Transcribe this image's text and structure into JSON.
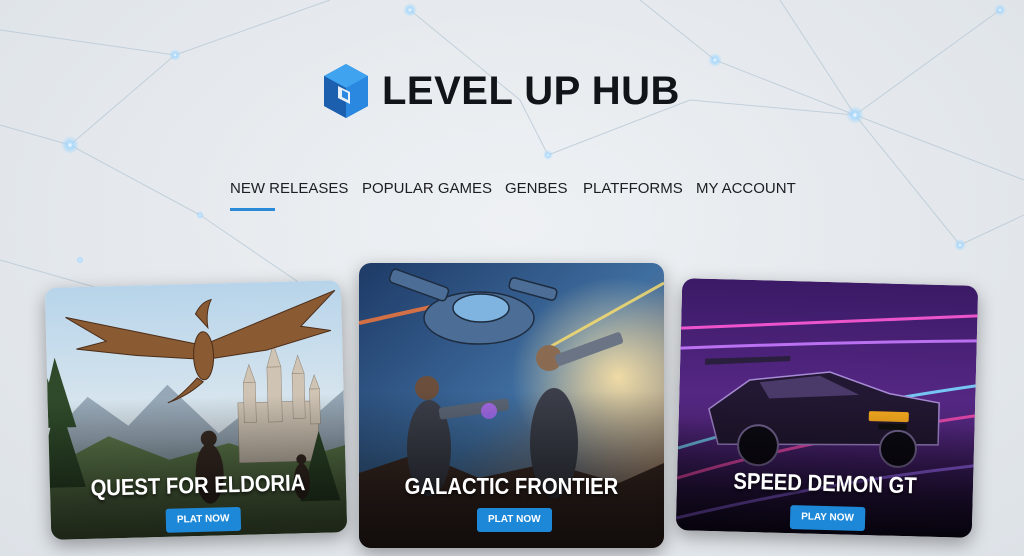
{
  "brand": {
    "name": "LEVEL UP HUB",
    "accent": "#2a8ad8"
  },
  "nav": {
    "active": "NEW RELEASES",
    "items": [
      {
        "label": "NEW RELEASES"
      },
      {
        "label": "POPULAR GAMES"
      },
      {
        "label": "GENBES"
      },
      {
        "label": "PLATFFORMS"
      },
      {
        "label": "MY ACCOUNT"
      }
    ]
  },
  "games": [
    {
      "title": "QUEST FOR ELDORIA",
      "button": "PLAT NOW",
      "art": "fantasy-dragon-castle"
    },
    {
      "title": "GALACTIC FRONTIER",
      "button": "PLAT NOW",
      "art": "sci-fi-space-soldiers"
    },
    {
      "title": "SPEED DEMON GT",
      "button": "PLAY NOW",
      "art": "neon-racing-car"
    }
  ]
}
